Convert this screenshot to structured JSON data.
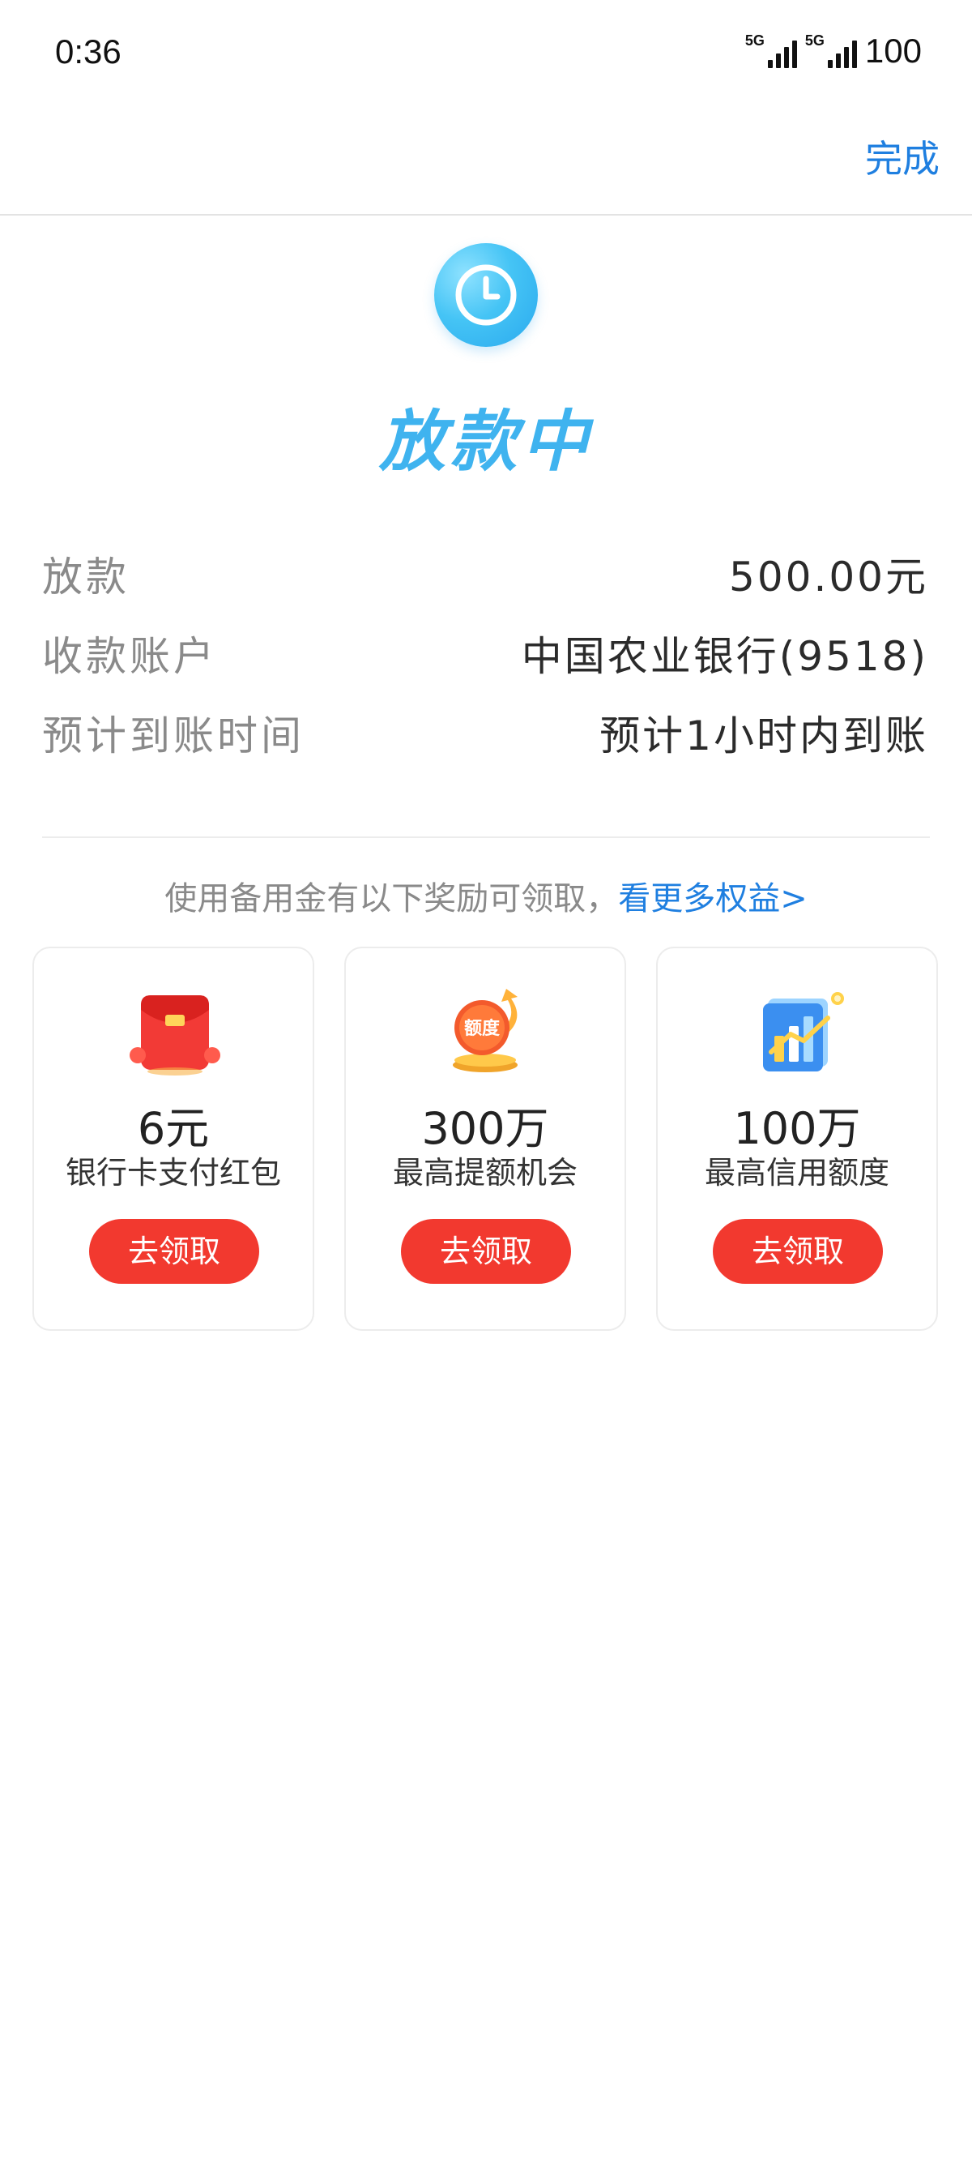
{
  "status_bar": {
    "time": "0:36",
    "network_1": "5G",
    "network_2": "5G",
    "battery": "100"
  },
  "header": {
    "done_label": "完成"
  },
  "status": {
    "icon": "clock-icon",
    "title": "放款中",
    "accent_color": "#3fb3ef"
  },
  "details": [
    {
      "label": "放款",
      "value": "500.00元"
    },
    {
      "label": "收款账户",
      "value": "中国农业银行(9518)"
    },
    {
      "label": "预计到账时间",
      "value": "预计1小时内到账"
    }
  ],
  "benefits": {
    "intro": "使用备用金有以下奖励可领取，",
    "more_link": "看更多权益>"
  },
  "rewards": [
    {
      "icon": "red-envelope-icon",
      "amount": "6元",
      "desc": "银行卡支付红包",
      "button": "去领取"
    },
    {
      "icon": "credit-limit-icon",
      "badge": "额度",
      "amount": "300万",
      "desc": "最高提额机会",
      "button": "去领取"
    },
    {
      "icon": "bar-chart-icon",
      "amount": "100万",
      "desc": "最高信用额度",
      "button": "去领取"
    }
  ],
  "colors": {
    "link": "#1f7fe0",
    "button": "#f2392f"
  }
}
